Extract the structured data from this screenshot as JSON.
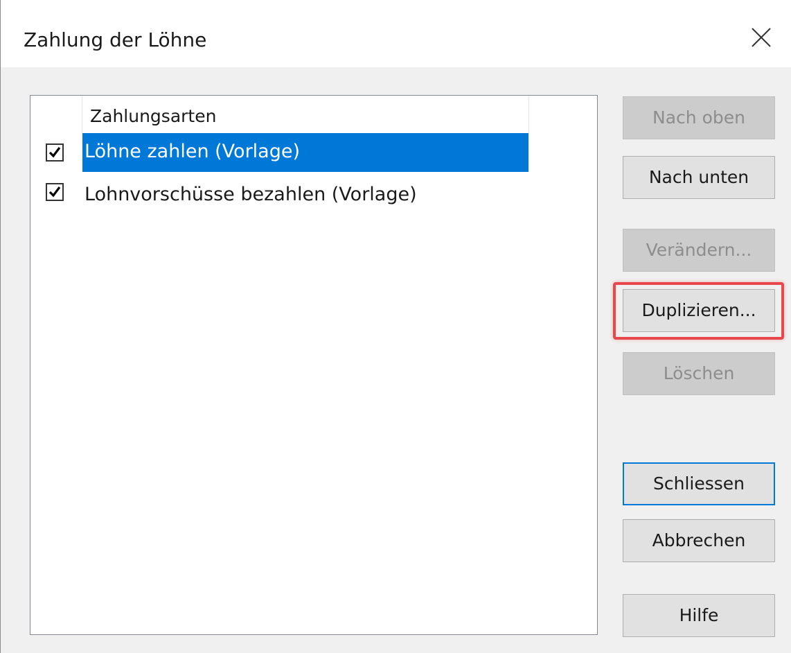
{
  "dialog": {
    "title": "Zahlung der Löhne",
    "close_icon": "close-icon"
  },
  "list": {
    "column_header": "Zahlungsarten",
    "rows": [
      {
        "label": "Löhne zahlen (Vorlage)",
        "checked": true,
        "selected": true
      },
      {
        "label": "Lohnvorschüsse bezahlen (Vorlage)",
        "checked": true,
        "selected": false
      }
    ]
  },
  "buttons": {
    "up": "Nach oben",
    "down": "Nach unten",
    "edit": "Verändern...",
    "duplicate": "Duplizieren...",
    "delete": "Löschen",
    "close": "Schliessen",
    "cancel": "Abbrechen",
    "help": "Hilfe"
  },
  "colors": {
    "selection": "#0078d7",
    "highlight_frame": "#e8474c",
    "dialog_bg": "#f0f0f0"
  }
}
